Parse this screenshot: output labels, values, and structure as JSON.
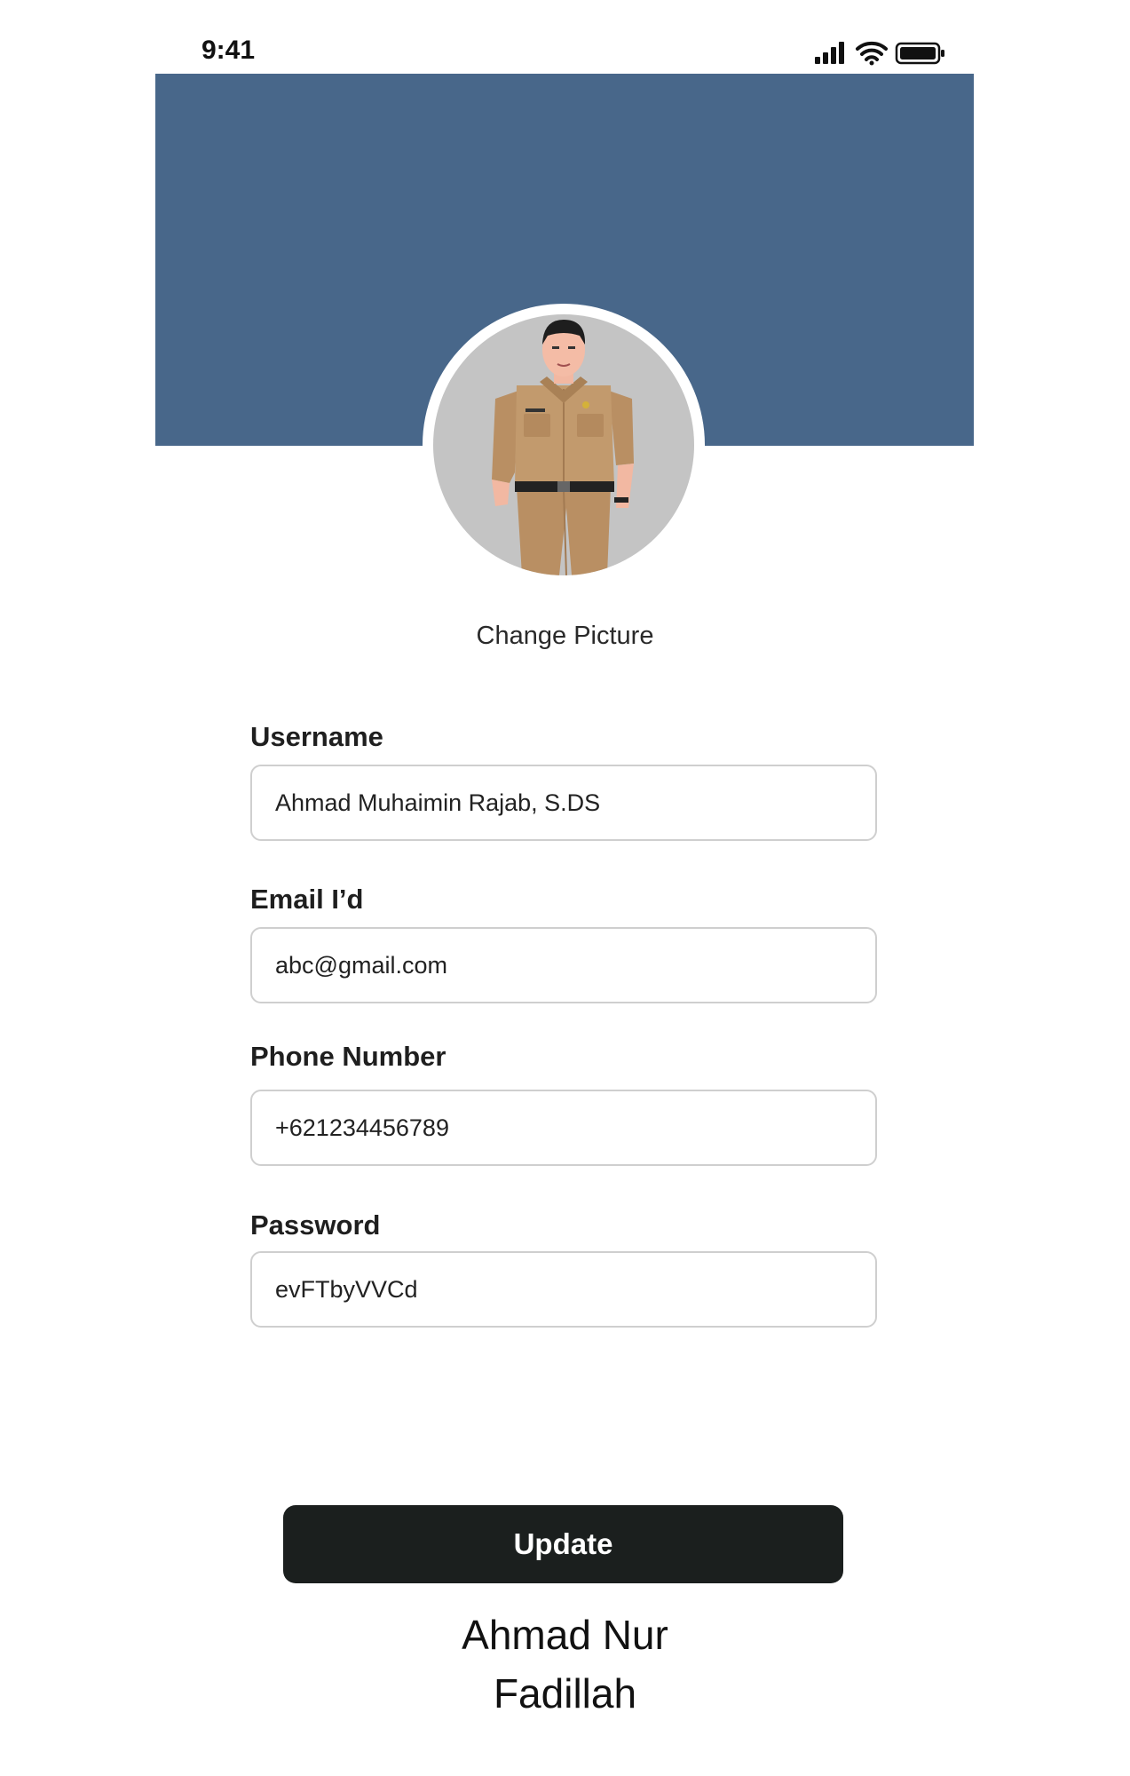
{
  "status_bar": {
    "time": "9:41",
    "icons": [
      "signal-icon",
      "wifi-icon",
      "battery-icon"
    ]
  },
  "profile": {
    "banner_color": "#48678a",
    "avatar_icon": "avatar-person-uniform",
    "change_picture_label": "Change Picture"
  },
  "form": {
    "username": {
      "label": "Username",
      "value": "Ahmad Muhaimin Rajab, S.DS"
    },
    "email": {
      "label": "Email I’d",
      "value": "abc@gmail.com"
    },
    "phone": {
      "label": "Phone Number",
      "value": "+621234456789"
    },
    "password": {
      "label": "Password",
      "value": "evFTbyVVCd"
    }
  },
  "update_label": "Update",
  "author": {
    "line1": "Ahmad Nur",
    "line2": "Fadillah"
  },
  "colors": {
    "button": "#1b1f1e",
    "avatar_bg": "#c4c4c4"
  }
}
